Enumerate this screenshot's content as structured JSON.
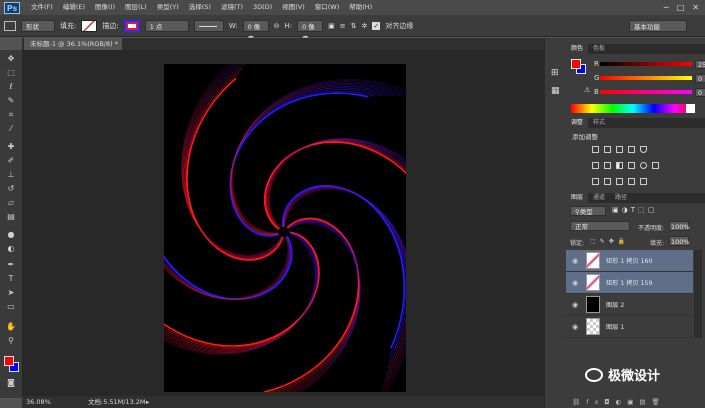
{
  "menu": {
    "logo": "Ps",
    "items": [
      "文件(F)",
      "编辑(E)",
      "图像(I)",
      "图层(L)",
      "类型(Y)",
      "选择(S)",
      "滤镜(T)",
      "3D(D)",
      "视图(V)",
      "窗口(W)",
      "帮助(H)"
    ],
    "window_controls": [
      "─",
      "□",
      "✕"
    ]
  },
  "options": {
    "shape_mode": "形状",
    "fill_label": "填充:",
    "stroke_label": "描边:",
    "stroke_width": "1 点",
    "w_label": "W:",
    "w_value": "0 像素",
    "h_label": "H:",
    "h_value": "0 像素",
    "align_edges_label": "对齐边缘",
    "workspace": "基本功能"
  },
  "document": {
    "tab_title": "未标题-1 @ 36.1%(RGB/8) *",
    "zoom": "36.08%",
    "doc_size": "文档:5.51M/13.2M"
  },
  "color_panel": {
    "tabs": [
      "颜色",
      "色板"
    ],
    "r_label": "R",
    "r_value": "255",
    "g_label": "G",
    "g_value": "0",
    "b_label": "B",
    "b_value": "0"
  },
  "adjust_panel": {
    "tabs": [
      "调整",
      "样式"
    ],
    "title": "添加调整"
  },
  "layers_panel": {
    "tabs": [
      "图层",
      "通道",
      "路径"
    ],
    "filter": "类型",
    "blend_mode": "正常",
    "opacity_label": "不透明度:",
    "opacity_value": "100%",
    "lock_label": "锁定:",
    "fill_label": "填充:",
    "fill_value": "100%",
    "layers": [
      {
        "name": "矩形 1 拷贝 160",
        "selected": true
      },
      {
        "name": "矩形 1 拷贝 159",
        "selected": true
      },
      {
        "name": "图层 2",
        "selected": false
      },
      {
        "name": "图层 1",
        "selected": false
      }
    ]
  },
  "watermark": "极微设计",
  "colors": {
    "foreground": "#ff0000",
    "background": "#0000ff",
    "selection": "#5f6e89",
    "spiral_red": "#ff1a1a",
    "spiral_blue": "#2a1aff"
  }
}
